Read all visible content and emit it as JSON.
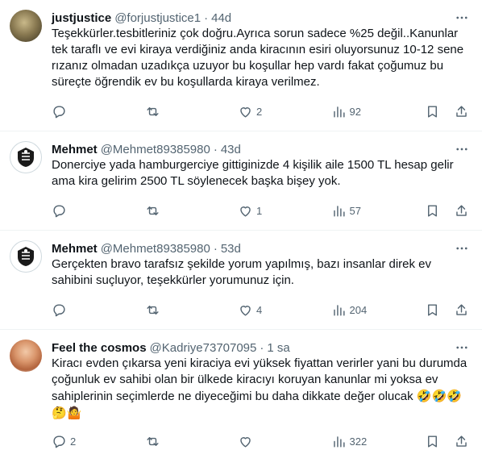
{
  "tweets": [
    {
      "name": "justjustice",
      "handle": "@forjustjustice1",
      "time": "44d",
      "text": "Teşekkürler.tesbitleriniz çok doğru.Ayrıca sorun sadece %25 değil..Kanunlar tek taraflı ve evi kiraya verdiğiniz anda kiracının esiri oluyorsunuz 10-12 sene rızanız olmadan uzadıkça uzuyor bu koşullar hep vardı fakat çoğumuz bu süreçte öğrendik ev bu koşullarda kiraya verilmez.",
      "replies": "",
      "retweets": "",
      "likes": "2",
      "views": "92"
    },
    {
      "name": "Mehmet",
      "handle": "@Mehmet89385980",
      "time": "43d",
      "text": "Donerciye yada hamburgerciye gittiginizde 4 kişilik aile 1500 TL hesap gelir ama kira gelirim 2500 TL söylenecek başka bişey yok.",
      "replies": "",
      "retweets": "",
      "likes": "1",
      "views": "57"
    },
    {
      "name": "Mehmet",
      "handle": "@Mehmet89385980",
      "time": "53d",
      "text": "Gerçekten bravo tarafsız şekilde yorum yapılmış, bazı insanlar direk ev sahibini suçluyor, teşekkürler yorumunuz için.",
      "replies": "",
      "retweets": "",
      "likes": "4",
      "views": "204"
    },
    {
      "name": "Feel the cosmos",
      "handle": "@Kadriye73707095",
      "time": "1 sa",
      "text": "Kiracı evden çıkarsa yeni kiraciya evi yüksek fiyattan verirler yani bu durumda çoğunluk ev sahibi olan bir ülkede kiracıyı koruyan kanunlar mi yoksa ev sahiplerinin seçimlerde ne diyeceğimi bu daha dikkate değer olucak ",
      "emojis": "🤣🤣🤣🤔🤷",
      "replies": "2",
      "retweets": "",
      "likes": "",
      "views": "322"
    }
  ],
  "separator": "·",
  "icons": [
    "more-icon",
    "reply-icon",
    "retweet-icon",
    "like-icon",
    "views-icon",
    "bookmark-icon",
    "share-icon"
  ],
  "colors": {
    "text": "#0f1419",
    "muted": "#536471",
    "border": "#eff3f4"
  }
}
